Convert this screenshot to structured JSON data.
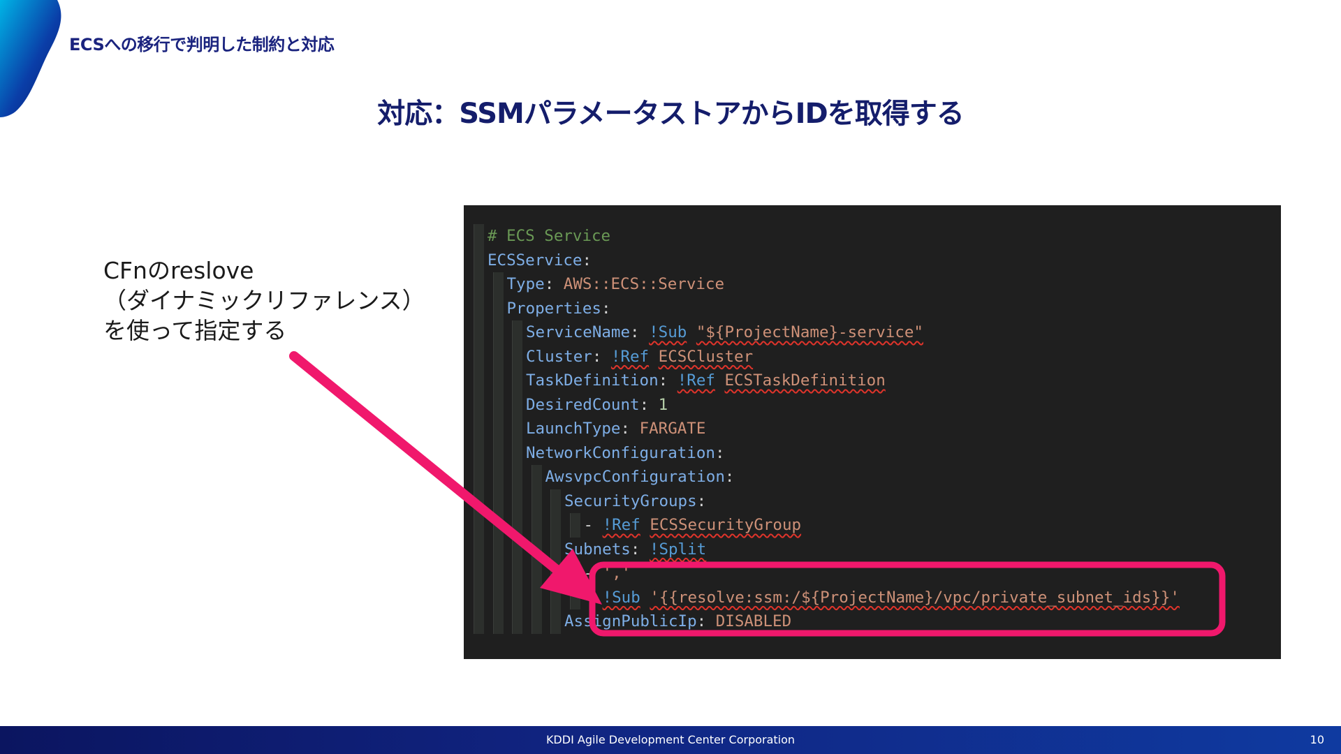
{
  "header": {
    "section_title": "ECSへの移行で判明した制約と対応",
    "main_title": "対応：SSMパラメータストアからIDを取得する"
  },
  "note": {
    "lines": [
      "CFnのreslove",
      "（ダイナミックリファレンス）",
      "を使って指定する"
    ]
  },
  "code": {
    "lines": [
      {
        "indent": 0,
        "parts": [
          {
            "t": "# ECS Service",
            "c": "comment"
          }
        ]
      },
      {
        "indent": 0,
        "parts": [
          {
            "t": "ECSService",
            "c": "key"
          },
          {
            "t": ":",
            "c": "colon"
          }
        ]
      },
      {
        "indent": 1,
        "parts": [
          {
            "t": "Type",
            "c": "key"
          },
          {
            "t": ": ",
            "c": "colon"
          },
          {
            "t": "AWS::ECS::Service",
            "c": "str"
          }
        ]
      },
      {
        "indent": 1,
        "parts": [
          {
            "t": "Properties",
            "c": "key"
          },
          {
            "t": ":",
            "c": "colon"
          }
        ]
      },
      {
        "indent": 2,
        "parts": [
          {
            "t": "ServiceName",
            "c": "key"
          },
          {
            "t": ": ",
            "c": "colon"
          },
          {
            "t": "!Sub",
            "c": "tag",
            "w": true
          },
          {
            "t": " ",
            "c": "plain"
          },
          {
            "t": "\"${ProjectName}-service\"",
            "c": "str",
            "w": true
          }
        ]
      },
      {
        "indent": 2,
        "parts": [
          {
            "t": "Cluster",
            "c": "key"
          },
          {
            "t": ": ",
            "c": "colon"
          },
          {
            "t": "!Ref",
            "c": "tag",
            "w": true
          },
          {
            "t": " ",
            "c": "plain"
          },
          {
            "t": "ECSCluster",
            "c": "str",
            "w": true
          }
        ]
      },
      {
        "indent": 2,
        "parts": [
          {
            "t": "TaskDefinition",
            "c": "key"
          },
          {
            "t": ": ",
            "c": "colon"
          },
          {
            "t": "!Ref",
            "c": "tag",
            "w": true
          },
          {
            "t": " ",
            "c": "plain"
          },
          {
            "t": "ECSTaskDefinition",
            "c": "str",
            "w": true
          }
        ]
      },
      {
        "indent": 2,
        "parts": [
          {
            "t": "DesiredCount",
            "c": "key"
          },
          {
            "t": ": ",
            "c": "colon"
          },
          {
            "t": "1",
            "c": "num"
          }
        ]
      },
      {
        "indent": 2,
        "parts": [
          {
            "t": "LaunchType",
            "c": "key"
          },
          {
            "t": ": ",
            "c": "colon"
          },
          {
            "t": "FARGATE",
            "c": "str"
          }
        ]
      },
      {
        "indent": 2,
        "parts": [
          {
            "t": "NetworkConfiguration",
            "c": "key"
          },
          {
            "t": ":",
            "c": "colon"
          }
        ]
      },
      {
        "indent": 3,
        "parts": [
          {
            "t": "AwsvpcConfiguration",
            "c": "key"
          },
          {
            "t": ":",
            "c": "colon"
          }
        ]
      },
      {
        "indent": 4,
        "parts": [
          {
            "t": "SecurityGroups",
            "c": "key"
          },
          {
            "t": ":",
            "c": "colon"
          }
        ]
      },
      {
        "indent": 5,
        "parts": [
          {
            "t": "- ",
            "c": "plain"
          },
          {
            "t": "!Ref",
            "c": "tag",
            "w": true
          },
          {
            "t": " ",
            "c": "plain"
          },
          {
            "t": "ECSSecurityGroup",
            "c": "str",
            "w": true
          }
        ]
      },
      {
        "indent": 4,
        "parts": [
          {
            "t": "Subnets",
            "c": "key"
          },
          {
            "t": ": ",
            "c": "colon"
          },
          {
            "t": "!Split",
            "c": "tag",
            "w": true
          }
        ]
      },
      {
        "indent": 5,
        "parts": [
          {
            "t": "- ",
            "c": "plain"
          },
          {
            "t": "','",
            "c": "str"
          }
        ]
      },
      {
        "indent": 5,
        "parts": [
          {
            "t": "- ",
            "c": "plain"
          },
          {
            "t": "!Sub",
            "c": "tag",
            "w": true
          },
          {
            "t": " ",
            "c": "plain"
          },
          {
            "t": "'{{resolve:ssm:/${ProjectName}/vpc/private_subnet_ids}}'",
            "c": "str",
            "w": true
          }
        ]
      },
      {
        "indent": 4,
        "parts": [
          {
            "t": "AssignPublicIp",
            "c": "key"
          },
          {
            "t": ": ",
            "c": "colon"
          },
          {
            "t": "DISABLED",
            "c": "str"
          }
        ]
      }
    ]
  },
  "colors": {
    "title": "#141d6b",
    "highlight": "#f0186c",
    "code_bg": "#1f1f1f",
    "footer": "#10237f"
  },
  "footer": {
    "company": "KDDI Agile Development Center Corporation",
    "page_number": "10"
  }
}
